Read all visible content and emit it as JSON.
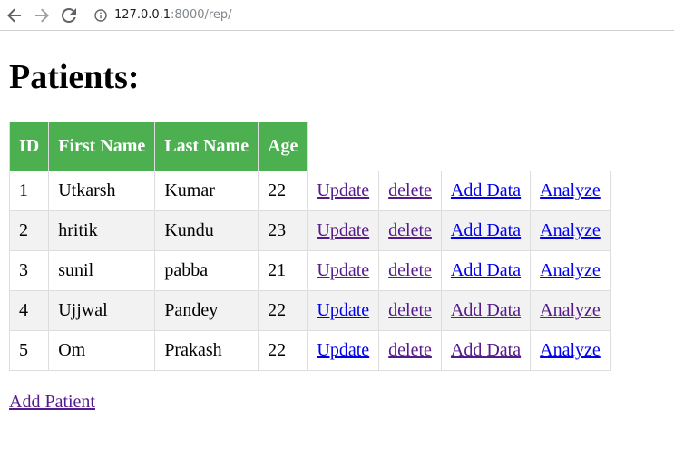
{
  "browser": {
    "url_host": "127.0.0.1",
    "url_path": ":8000/rep/"
  },
  "page": {
    "title": "Patients:",
    "add_patient_label": "Add Patient"
  },
  "table": {
    "headers": [
      "ID",
      "First Name",
      "Last Name",
      "Age"
    ],
    "action_labels": {
      "update": "Update",
      "delete": "delete",
      "add_data": "Add Data",
      "analyze": "Analyze"
    },
    "rows": [
      {
        "id": "1",
        "first": "Utkarsh",
        "last": "Kumar",
        "age": "22"
      },
      {
        "id": "2",
        "first": "hritik",
        "last": "Kundu",
        "age": "23"
      },
      {
        "id": "3",
        "first": "sunil",
        "last": "pabba",
        "age": "21"
      },
      {
        "id": "4",
        "first": "Ujjwal",
        "last": "Pandey",
        "age": "22"
      },
      {
        "id": "5",
        "first": "Om",
        "last": "Prakash",
        "age": "22"
      }
    ]
  },
  "colors": {
    "header_bg": "#4caf50",
    "link": "#0000ee",
    "visited_link": "#551a8b",
    "even_row_bg": "#f2f2f2"
  }
}
